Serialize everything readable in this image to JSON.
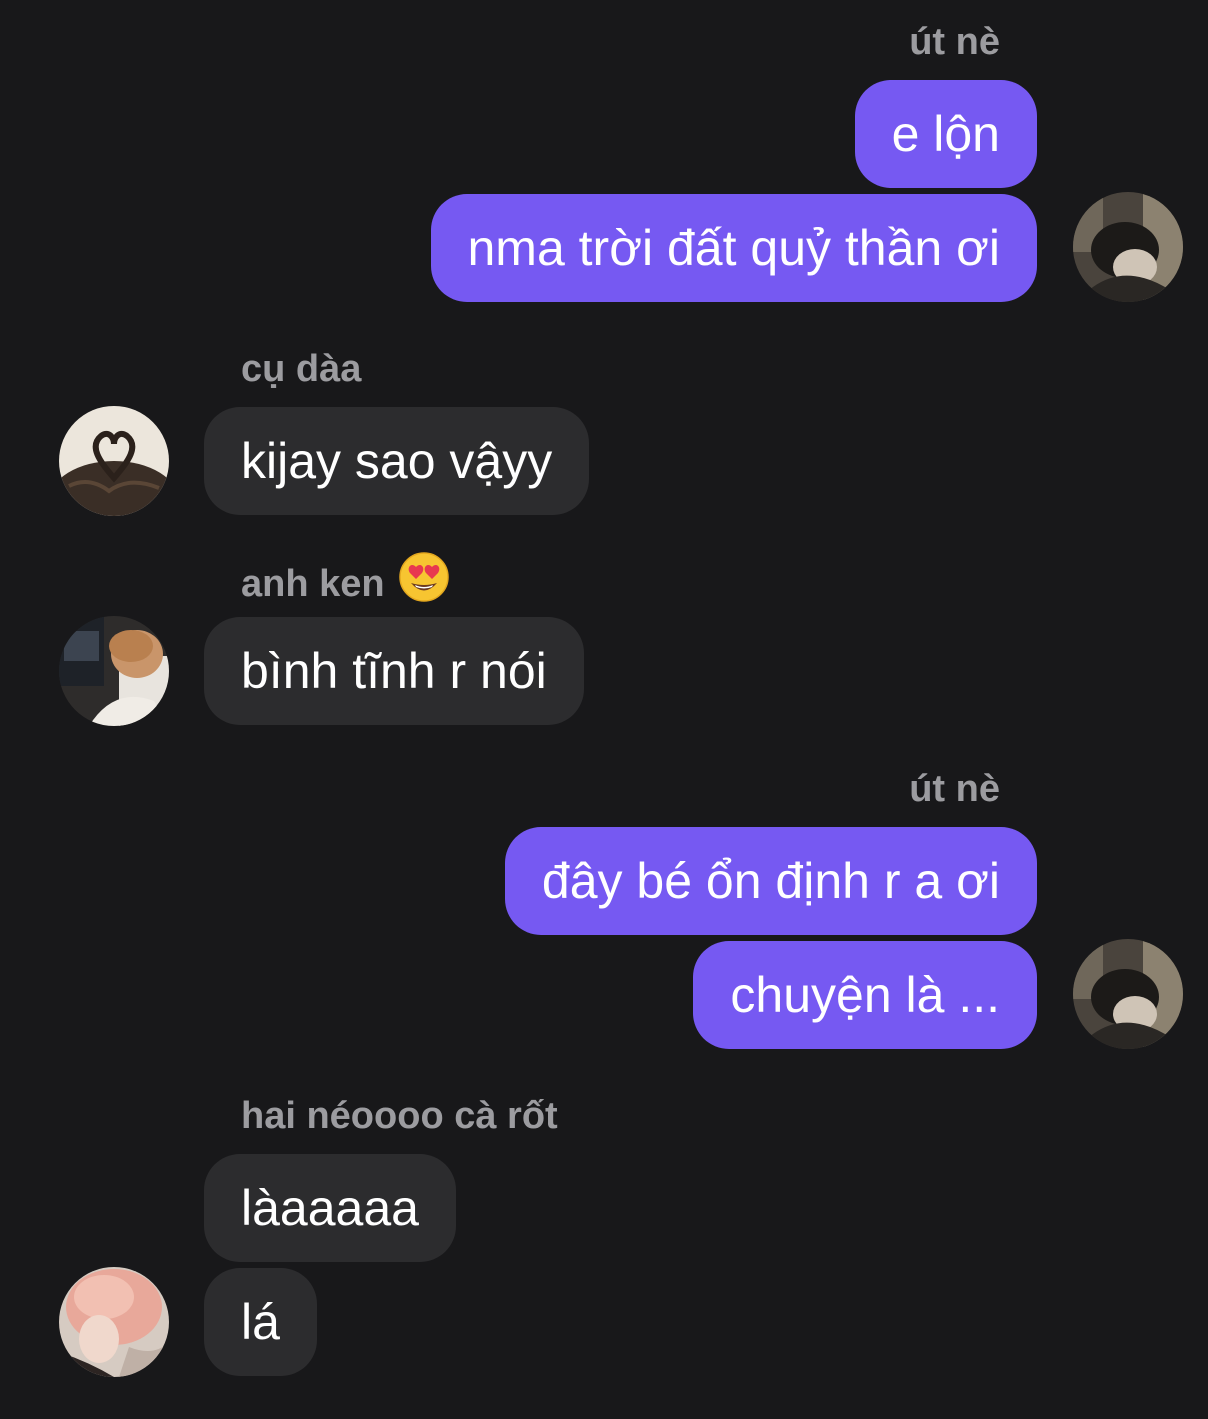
{
  "messages": [
    {
      "sender": "út nè",
      "texts": [
        "e lộn",
        "nma trời đất quỷ thần ơi"
      ]
    },
    {
      "sender": "cụ dàa",
      "texts": [
        "kijay sao vậyy"
      ]
    },
    {
      "sender": "anh ken",
      "texts": [
        "bình tĩnh r nói"
      ]
    },
    {
      "sender": "út nè",
      "texts": [
        "đây bé ổn định r a ơi",
        "chuyện là ..."
      ]
    },
    {
      "sender": "hai néoooo cà rốt",
      "texts": [
        "làaaaaa",
        "lá"
      ]
    }
  ],
  "colors": {
    "background": "#18181a",
    "outgoing_bubble": "#7659f2",
    "incoming_bubble": "#2c2c2e",
    "sender_name": "#9c9ca0",
    "message_text": "#ffffff"
  },
  "icons": {
    "sender_emoji": "heart-eyes-emoji"
  }
}
